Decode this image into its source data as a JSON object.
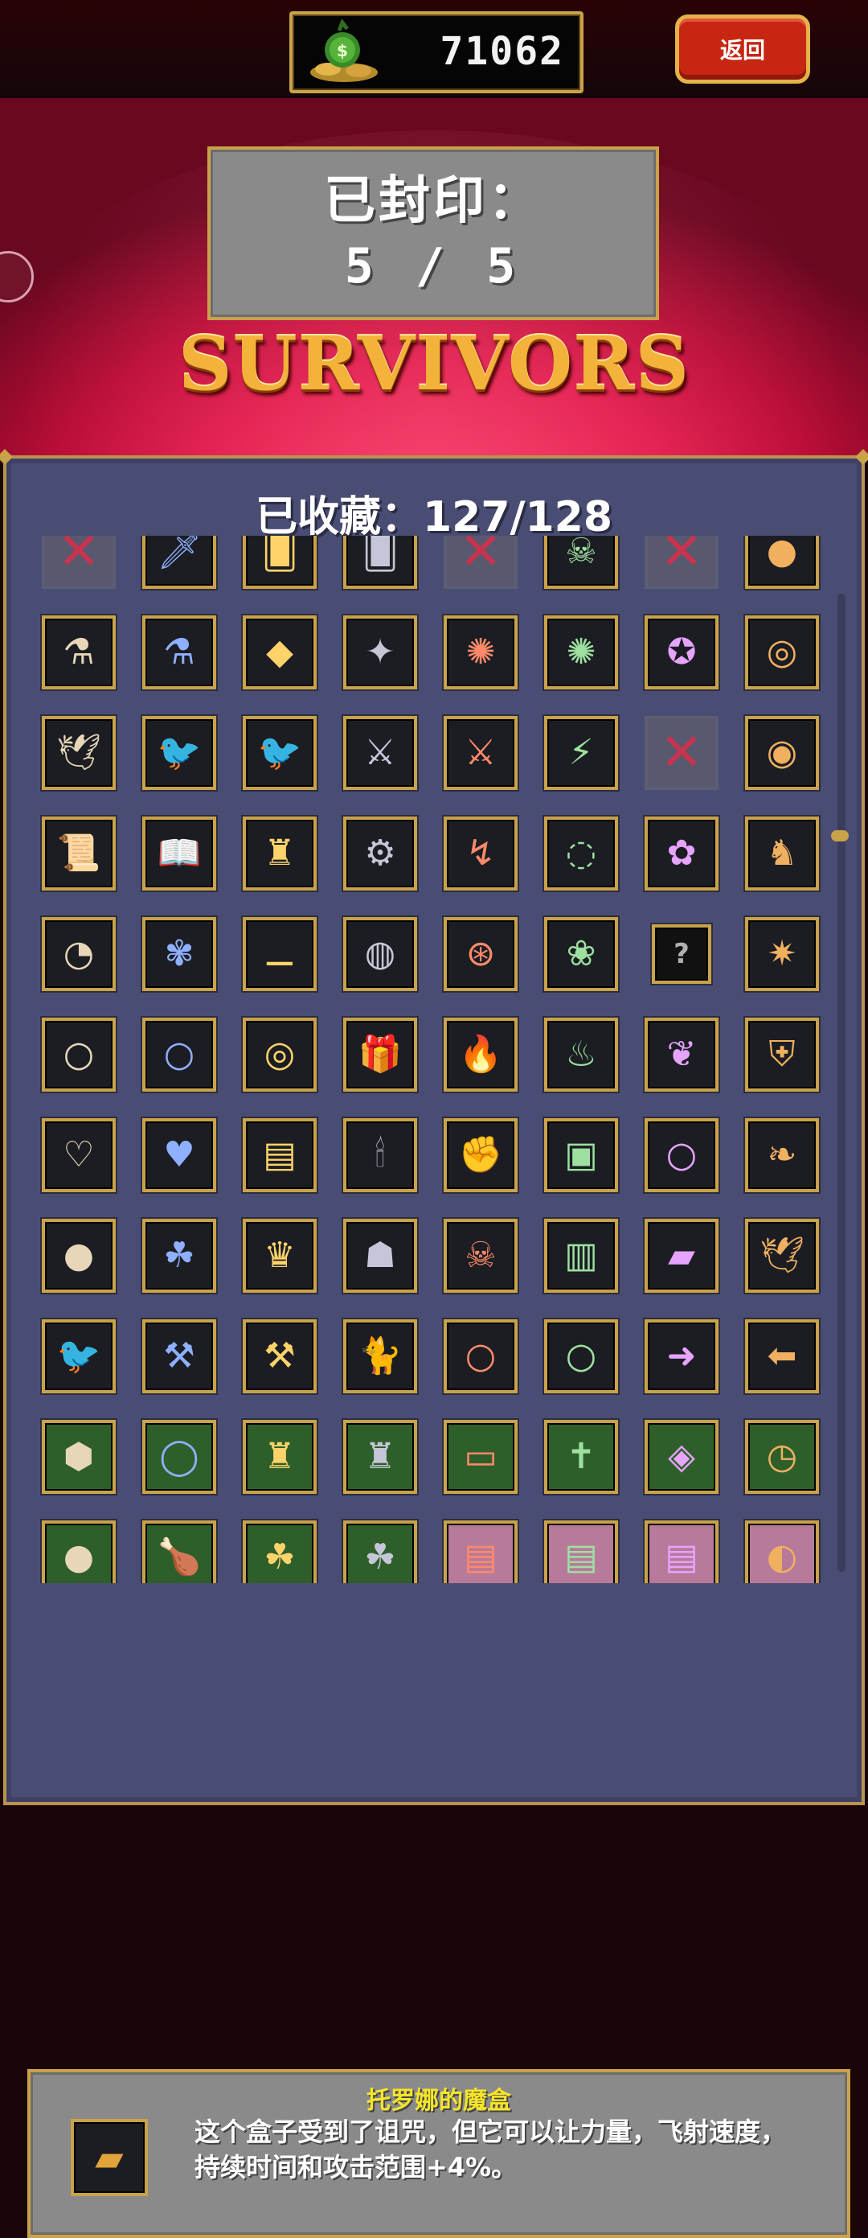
{
  "header": {
    "coins": "71062",
    "back_label": "返回"
  },
  "banner": {
    "sealed_title": "已封印：",
    "sealed_count": "5 / 5",
    "logo": "SURVIVORS"
  },
  "collection": {
    "title": "已收藏：127/128"
  },
  "items": [
    {
      "icon": "sealed-x-icon",
      "glyph": "✕",
      "style": "sealed"
    },
    {
      "icon": "sword-icon",
      "glyph": "🗡",
      "style": ""
    },
    {
      "icon": "blue-card-icon",
      "glyph": "🂠",
      "style": ""
    },
    {
      "icon": "red-card-icon",
      "glyph": "🂠",
      "style": ""
    },
    {
      "icon": "sealed-x-icon",
      "glyph": "✕",
      "style": "sealed"
    },
    {
      "icon": "skull-icon",
      "glyph": "☠",
      "style": ""
    },
    {
      "icon": "sealed-x-icon",
      "glyph": "✕",
      "style": "sealed"
    },
    {
      "icon": "orb-icon",
      "glyph": "●",
      "style": ""
    },
    {
      "icon": "blue-potion-icon",
      "glyph": "⚗",
      "style": ""
    },
    {
      "icon": "crystal-flask-icon",
      "glyph": "⚗",
      "style": ""
    },
    {
      "icon": "diamond-icon",
      "glyph": "◆",
      "style": ""
    },
    {
      "icon": "gem-cross-icon",
      "glyph": "✦",
      "style": ""
    },
    {
      "icon": "orbit-icon",
      "glyph": "✺",
      "style": ""
    },
    {
      "icon": "gold-orbit-icon",
      "glyph": "✺",
      "style": ""
    },
    {
      "icon": "purple-pentagram-icon",
      "glyph": "✪",
      "style": ""
    },
    {
      "icon": "purple-spiral-icon",
      "glyph": "◎",
      "style": ""
    },
    {
      "icon": "white-dove-icon",
      "glyph": "🕊",
      "style": ""
    },
    {
      "icon": "purple-bird-icon",
      "glyph": "🐦",
      "style": ""
    },
    {
      "icon": "green-bird-icon",
      "glyph": "🐦",
      "style": ""
    },
    {
      "icon": "crossbow-icon",
      "glyph": "⚔",
      "style": ""
    },
    {
      "icon": "blue-crossbow-icon",
      "glyph": "⚔",
      "style": ""
    },
    {
      "icon": "triple-knives-icon",
      "glyph": "⚡",
      "style": ""
    },
    {
      "icon": "sealed-x-icon",
      "glyph": "✕",
      "style": "sealed"
    },
    {
      "icon": "golden-eye-icon",
      "glyph": "◉",
      "style": ""
    },
    {
      "icon": "scroll-icon",
      "glyph": "📜",
      "style": ""
    },
    {
      "icon": "spellbook-icon",
      "glyph": "📖",
      "style": ""
    },
    {
      "icon": "dark-robe-icon",
      "glyph": "♜",
      "style": ""
    },
    {
      "icon": "machine-icon",
      "glyph": "⚙",
      "style": ""
    },
    {
      "icon": "blue-whip-icon",
      "glyph": "↯",
      "style": ""
    },
    {
      "icon": "spiral-shell-icon",
      "glyph": "◌",
      "style": ""
    },
    {
      "icon": "green-sprout-icon",
      "glyph": "✿",
      "style": ""
    },
    {
      "icon": "red-cloak-icon",
      "glyph": "♞",
      "style": ""
    },
    {
      "icon": "blue-chakram-icon",
      "glyph": "◔",
      "style": ""
    },
    {
      "icon": "red-rose-icon",
      "glyph": "✾",
      "style": ""
    },
    {
      "icon": "bone-icon",
      "glyph": "⚊",
      "style": ""
    },
    {
      "icon": "planet-icon",
      "glyph": "◍",
      "style": ""
    },
    {
      "icon": "wheel-icon",
      "glyph": "⊛",
      "style": ""
    },
    {
      "icon": "flowers-icon",
      "glyph": "❀",
      "style": ""
    },
    {
      "icon": "unknown-icon",
      "glyph": "?",
      "style": "unknown"
    },
    {
      "icon": "fireworks-icon",
      "glyph": "✷",
      "style": ""
    },
    {
      "icon": "blue-ring-icon",
      "glyph": "○",
      "style": ""
    },
    {
      "icon": "green-ring-icon",
      "glyph": "○",
      "style": ""
    },
    {
      "icon": "double-ring-icon",
      "glyph": "◎",
      "style": ""
    },
    {
      "icon": "gift-box-icon",
      "glyph": "🎁",
      "style": ""
    },
    {
      "icon": "fire-icon",
      "glyph": "🔥",
      "style": ""
    },
    {
      "icon": "grey-flame-icon",
      "glyph": "♨",
      "style": ""
    },
    {
      "icon": "green-leaf-icon",
      "glyph": "❦",
      "style": ""
    },
    {
      "icon": "armor-icon",
      "glyph": "⛨",
      "style": ""
    },
    {
      "icon": "empty-heart-icon",
      "glyph": "♡",
      "style": ""
    },
    {
      "icon": "red-heart-icon",
      "glyph": "♥",
      "style": ""
    },
    {
      "icon": "red-tome-icon",
      "glyph": "▤",
      "style": ""
    },
    {
      "icon": "candelabra-icon",
      "glyph": "🕯",
      "style": ""
    },
    {
      "icon": "gauntlet-icon",
      "glyph": "✊",
      "style": ""
    },
    {
      "icon": "golden-frame-icon",
      "glyph": "▣",
      "style": ""
    },
    {
      "icon": "gold-ring-icon",
      "glyph": "○",
      "style": ""
    },
    {
      "icon": "white-wings-icon",
      "glyph": "❧",
      "style": ""
    },
    {
      "icon": "blue-orb-icon",
      "glyph": "●",
      "style": ""
    },
    {
      "icon": "clover-icon",
      "glyph": "☘",
      "style": ""
    },
    {
      "icon": "crown-icon",
      "glyph": "♛",
      "style": ""
    },
    {
      "icon": "mask-icon",
      "glyph": "☗",
      "style": ""
    },
    {
      "icon": "skull-mask-icon",
      "glyph": "☠",
      "style": ""
    },
    {
      "icon": "cake-icon",
      "glyph": "▥",
      "style": ""
    },
    {
      "icon": "gold-bar-icon",
      "glyph": "▰",
      "style": ""
    },
    {
      "icon": "blue-dove-icon",
      "glyph": "🕊",
      "style": ""
    },
    {
      "icon": "red-bird-icon",
      "glyph": "🐦",
      "style": ""
    },
    {
      "icon": "red-axe-icon",
      "glyph": "⚒",
      "style": ""
    },
    {
      "icon": "blue-axe-icon",
      "glyph": "⚒",
      "style": ""
    },
    {
      "icon": "cat-icon",
      "glyph": "🐈",
      "style": ""
    },
    {
      "icon": "grey-ring-icon",
      "glyph": "○",
      "style": ""
    },
    {
      "icon": "yellow-ring-icon",
      "glyph": "○",
      "style": ""
    },
    {
      "icon": "red-arrow-right-icon",
      "glyph": "➜",
      "style": ""
    },
    {
      "icon": "red-arrow-left-icon",
      "glyph": "⬅",
      "style": ""
    },
    {
      "icon": "blue-crystal-icon",
      "glyph": "⬢",
      "style": "green"
    },
    {
      "icon": "gold-coin-icon",
      "glyph": "◯",
      "style": "green"
    },
    {
      "icon": "red-bag-icon",
      "glyph": "♜",
      "style": "green"
    },
    {
      "icon": "pink-bag-icon",
      "glyph": "♜",
      "style": "green"
    },
    {
      "icon": "treasure-chest-icon",
      "glyph": "▭",
      "style": "green"
    },
    {
      "icon": "rosary-icon",
      "glyph": "✝",
      "style": "green"
    },
    {
      "icon": "orange-scroll-icon",
      "glyph": "◈",
      "style": "green"
    },
    {
      "icon": "stopwatch-icon",
      "glyph": "◷",
      "style": "green"
    },
    {
      "icon": "blue-orb-icon",
      "glyph": "●",
      "style": "green"
    },
    {
      "icon": "roast-chicken-icon",
      "glyph": "🍗",
      "style": "green"
    },
    {
      "icon": "gold-clover-icon",
      "glyph": "☘",
      "style": "green"
    },
    {
      "icon": "green-clover-icon",
      "glyph": "☘",
      "style": "green"
    },
    {
      "icon": "purple-book-icon",
      "glyph": "▤",
      "style": "pink"
    },
    {
      "icon": "golden-book-icon",
      "glyph": "▤",
      "style": "pink"
    },
    {
      "icon": "dark-book-icon",
      "glyph": "▤",
      "style": "pink"
    },
    {
      "icon": "golden-egg-icon",
      "glyph": "◐",
      "style": "pink"
    }
  ],
  "selected_item": {
    "name": "托罗娜的魔盒",
    "icon": "gold-bar-icon",
    "glyph": "▰",
    "description_line1": "这个盒子受到了诅咒，但它可以让力量，飞射速度，",
    "description_line2": "持续时间和攻击范围+4%。"
  }
}
